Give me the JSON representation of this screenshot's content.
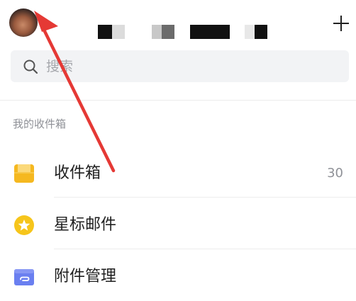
{
  "header": {
    "avatar": "user-avatar"
  },
  "search": {
    "placeholder": "搜索",
    "icon": "search-icon"
  },
  "section": {
    "title": "我的收件箱"
  },
  "items": [
    {
      "label": "收件箱",
      "count": "30",
      "icon": "inbox-icon",
      "color": "#f5b820"
    },
    {
      "label": "星标邮件",
      "icon": "star-icon",
      "color": "#f6c51b"
    },
    {
      "label": "附件管理",
      "icon": "attachment-icon",
      "color": "#6a7ff0"
    }
  ],
  "annotation": {
    "color": "#e53935"
  }
}
